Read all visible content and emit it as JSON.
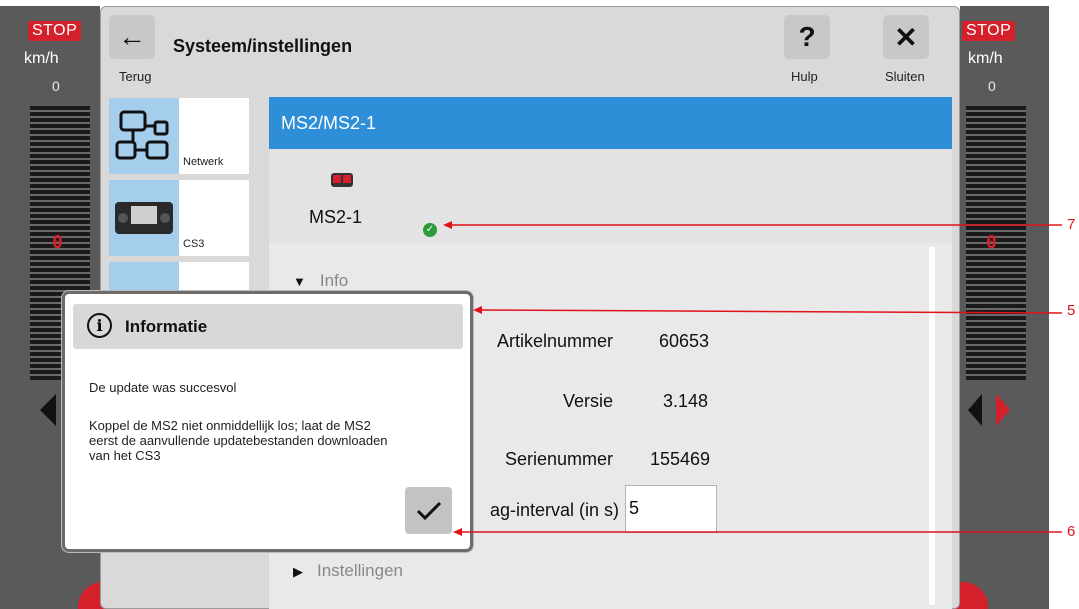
{
  "sides": {
    "left": {
      "stop": "STOP",
      "unit": "km/h",
      "speed": "0",
      "big_zero": "0"
    },
    "right": {
      "stop": "STOP",
      "unit": "km/h",
      "speed": "0",
      "big_zero": "0"
    }
  },
  "titlebar": {
    "back_label": "Terug",
    "title": "Systeem/instellingen",
    "help_label": "Hulp",
    "close_label": "Sluiten",
    "help_glyph": "?",
    "close_glyph": "✕",
    "back_glyph": "←"
  },
  "devices": [
    {
      "label": "Netwerk",
      "icon": "network-icon"
    },
    {
      "label": "CS3",
      "icon": "cs3-device-icon"
    },
    {
      "label": "",
      "icon": "device-icon"
    }
  ],
  "content": {
    "header": "MS2/MS2-1",
    "device_name": "MS2-1",
    "info_section": "Info",
    "settings_section": "Instellingen",
    "fields": [
      {
        "label": "Artikelnummer",
        "value": "60653"
      },
      {
        "label": "Versie",
        "value": "3.148"
      },
      {
        "label": "Serienummer",
        "value": "155469"
      }
    ],
    "interval_label": "ag-interval (in s)",
    "interval_value": "5"
  },
  "popup": {
    "title": "Informatie",
    "line1": "De update was succesvol",
    "line2": "Koppel de MS2 niet onmiddellijk los; laat de MS2",
    "line3": "eerst de aanvullende updatebestanden downloaden",
    "line4": "van het CS3"
  },
  "callouts": [
    "7",
    "5",
    "6"
  ],
  "colors": {
    "accent": "#2e8fd8",
    "callout": "#e0131b",
    "stop": "#d3202b",
    "ok": "#2c9b3a"
  }
}
